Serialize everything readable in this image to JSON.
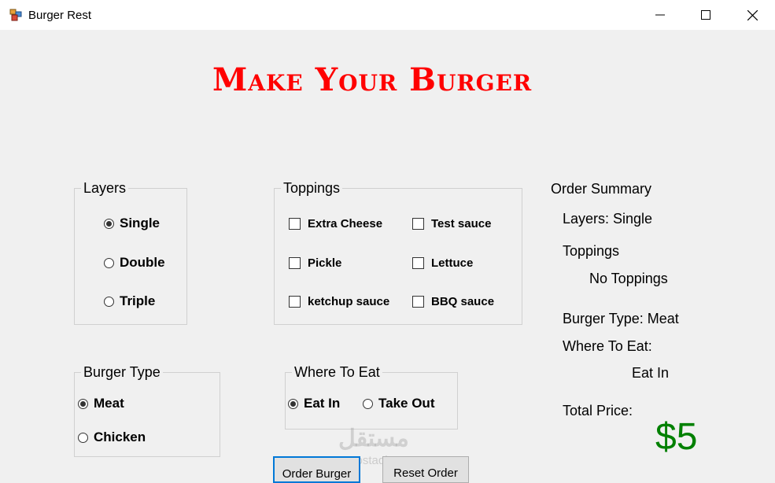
{
  "window": {
    "title": "Burger Rest",
    "icon": "app-window-icon"
  },
  "header": {
    "title": "Make Your Burger"
  },
  "layers": {
    "legend": "Layers",
    "options": [
      {
        "label": "Single",
        "checked": true
      },
      {
        "label": "Double",
        "checked": false
      },
      {
        "label": "Triple",
        "checked": false
      }
    ]
  },
  "toppings": {
    "legend": "Toppings",
    "options": [
      {
        "label": "Extra Cheese",
        "checked": false
      },
      {
        "label": "Test sauce",
        "checked": false
      },
      {
        "label": "Pickle",
        "checked": false
      },
      {
        "label": "Lettuce",
        "checked": false
      },
      {
        "label": "ketchup sauce",
        "checked": false
      },
      {
        "label": "BBQ sauce",
        "checked": false
      }
    ]
  },
  "burger_type": {
    "legend": "Burger Type",
    "options": [
      {
        "label": "Meat",
        "checked": true
      },
      {
        "label": "Chicken",
        "checked": false
      }
    ]
  },
  "where_to_eat": {
    "legend": "Where To Eat",
    "options": [
      {
        "label": "Eat In",
        "checked": true
      },
      {
        "label": "Take Out",
        "checked": false
      }
    ]
  },
  "summary": {
    "heading": "Order Summary",
    "layers": "Layers: Single",
    "toppings_label": "Toppings",
    "toppings_value": "No Toppings",
    "burger_type": "Burger Type: Meat",
    "where_label": "Where To Eat:",
    "where_value": "Eat In",
    "total_label": "Total Price:",
    "total_value": "$5"
  },
  "buttons": {
    "order": "Order Burger",
    "reset": "Reset Order"
  },
  "watermark": {
    "main": "مستقل",
    "sub": "mostaql.com"
  },
  "colors": {
    "title": "#ff0000",
    "price": "#008000",
    "focus": "#0078d7"
  }
}
